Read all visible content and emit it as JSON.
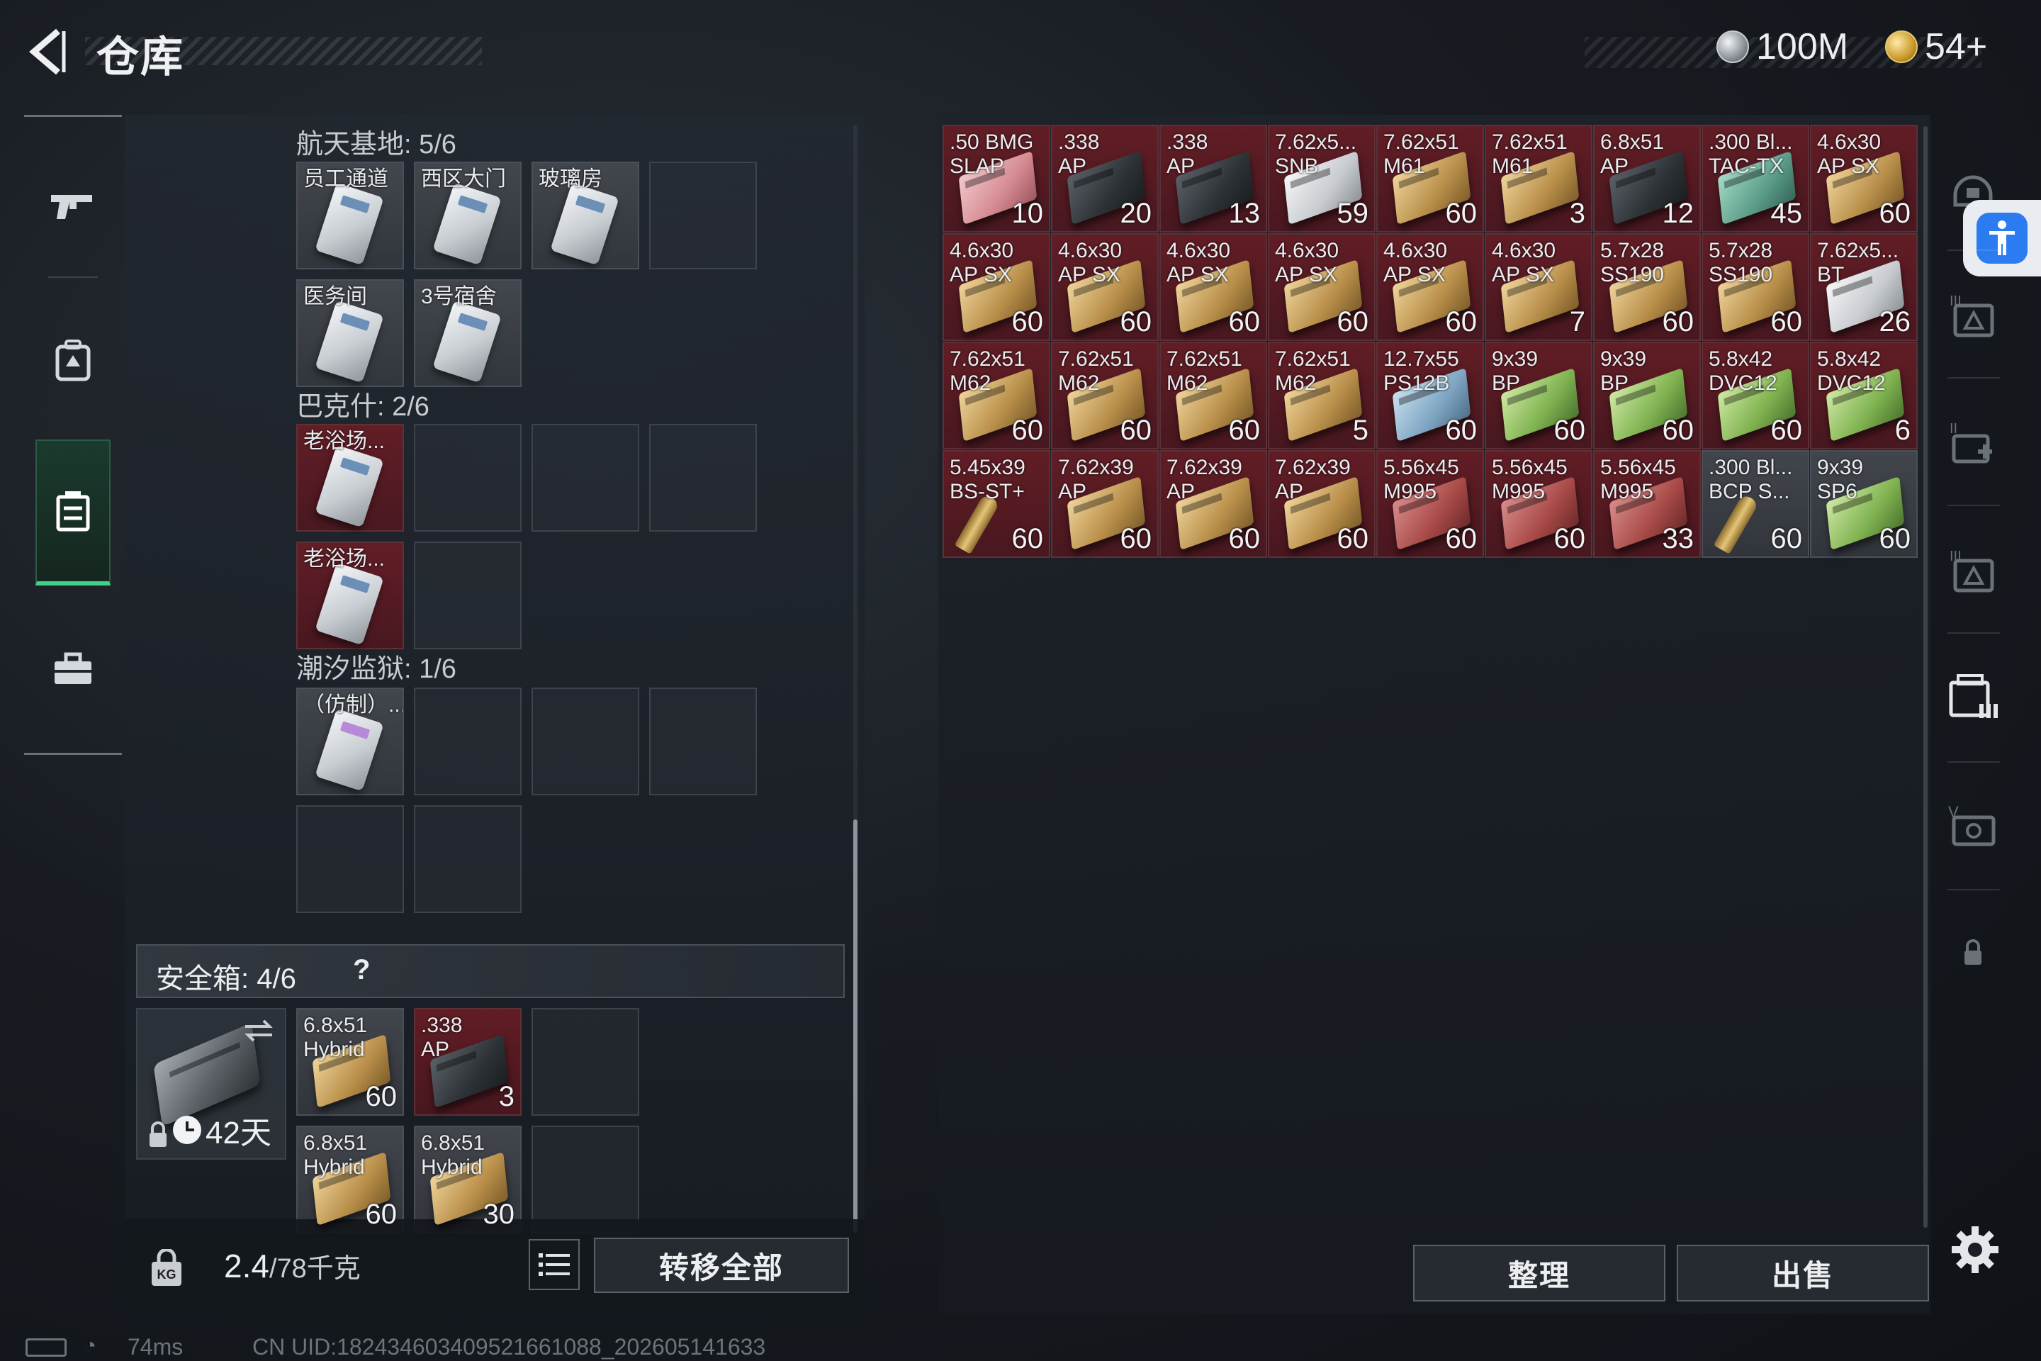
{
  "header": {
    "title": "仓库",
    "currencies": [
      {
        "icon": "silver-coin-icon",
        "value": "100M"
      },
      {
        "icon": "gold-coin-icon",
        "value": "54+"
      }
    ]
  },
  "left_nav": {
    "items": [
      {
        "name": "weapon",
        "icon": "gun-icon",
        "active": false
      },
      {
        "name": "equipment",
        "icon": "backpack-icon",
        "active": false
      },
      {
        "name": "storage",
        "icon": "container-icon",
        "active": true
      },
      {
        "name": "toolbox",
        "icon": "toolbox-icon",
        "active": false
      }
    ]
  },
  "keycard_sections": [
    {
      "title": "航天基地: 5/6",
      "cells": [
        {
          "label": "员工通道",
          "type": "keycard"
        },
        {
          "label": "西区大门",
          "type": "keycard"
        },
        {
          "label": "玻璃房",
          "type": "keycard"
        },
        {
          "label": "",
          "type": "empty"
        },
        {
          "label": "医务间",
          "type": "keycard"
        },
        {
          "label": "3号宿舍",
          "type": "keycard"
        }
      ]
    },
    {
      "title": "巴克什: 2/6",
      "cells": [
        {
          "label": "老浴场...",
          "type": "keycard-red"
        },
        {
          "label": "",
          "type": "empty"
        },
        {
          "label": "",
          "type": "empty"
        },
        {
          "label": "",
          "type": "empty"
        },
        {
          "label": "老浴场...",
          "type": "keycard-red"
        },
        {
          "label": "",
          "type": "empty"
        }
      ]
    },
    {
      "title": "潮汐监狱: 1/6",
      "cells": [
        {
          "label": "（仿制）...",
          "type": "keycard-fake"
        },
        {
          "label": "",
          "type": "empty"
        },
        {
          "label": "",
          "type": "empty"
        },
        {
          "label": "",
          "type": "empty"
        },
        {
          "label": "",
          "type": "empty"
        },
        {
          "label": "",
          "type": "empty"
        }
      ]
    }
  ],
  "safebox": {
    "label": "安全箱:  4/6",
    "help": "?",
    "case_days": "42天",
    "items": [
      {
        "line1": "6.8x51",
        "line2": "Hybrid",
        "qty": "60",
        "box": "tan"
      },
      {
        "line1": ".338",
        "line2": "AP",
        "qty": "3",
        "box": "dark",
        "red": true
      },
      {
        "line1": "",
        "line2": "",
        "qty": "",
        "box": ""
      },
      {
        "line1": "6.8x51",
        "line2": "Hybrid",
        "qty": "60",
        "box": "tan"
      },
      {
        "line1": "6.8x51",
        "line2": "Hybrid",
        "qty": "30",
        "box": "tan"
      },
      {
        "line1": "",
        "line2": "",
        "qty": "",
        "box": ""
      }
    ]
  },
  "footer_left": {
    "weight_current": "2.4",
    "weight_capacity": "/78千克",
    "transfer_all": "转移全部"
  },
  "stash_items": [
    {
      "line1": ".50 BMG",
      "line2": "SLAP",
      "qty": "10",
      "box": "pink",
      "red": true
    },
    {
      "line1": ".338",
      "line2": "AP",
      "qty": "20",
      "box": "dark",
      "red": true
    },
    {
      "line1": ".338",
      "line2": "AP",
      "qty": "13",
      "box": "dark",
      "red": true
    },
    {
      "line1": "7.62x5...",
      "line2": "SNB",
      "qty": "59",
      "box": "white",
      "red": true
    },
    {
      "line1": "7.62x51",
      "line2": "M61",
      "qty": "60",
      "box": "tan",
      "red": true
    },
    {
      "line1": "7.62x51",
      "line2": "M61",
      "qty": "3",
      "box": "tan",
      "red": true
    },
    {
      "line1": "6.8x51",
      "line2": "AP",
      "qty": "12",
      "box": "dark",
      "red": true
    },
    {
      "line1": ".300 Bl...",
      "line2": "TAC-TX",
      "qty": "45",
      "box": "teal",
      "red": true
    },
    {
      "line1": "4.6x30",
      "line2": "AP SX",
      "qty": "60",
      "box": "tan",
      "red": true
    },
    {
      "line1": "4.6x30",
      "line2": "AP SX",
      "qty": "60",
      "box": "tan",
      "red": true
    },
    {
      "line1": "4.6x30",
      "line2": "AP SX",
      "qty": "60",
      "box": "tan",
      "red": true
    },
    {
      "line1": "4.6x30",
      "line2": "AP SX",
      "qty": "60",
      "box": "tan",
      "red": true
    },
    {
      "line1": "4.6x30",
      "line2": "AP SX",
      "qty": "60",
      "box": "tan",
      "red": true
    },
    {
      "line1": "4.6x30",
      "line2": "AP SX",
      "qty": "60",
      "box": "tan",
      "red": true
    },
    {
      "line1": "4.6x30",
      "line2": "AP SX",
      "qty": "7",
      "box": "tan",
      "red": true
    },
    {
      "line1": "5.7x28",
      "line2": "SS190",
      "qty": "60",
      "box": "tan",
      "red": true
    },
    {
      "line1": "5.7x28",
      "line2": "SS190",
      "qty": "60",
      "box": "tan",
      "red": true
    },
    {
      "line1": "7.62x5...",
      "line2": "BT",
      "qty": "26",
      "box": "white",
      "red": true
    },
    {
      "line1": "7.62x51",
      "line2": "M62",
      "qty": "60",
      "box": "tan",
      "red": true
    },
    {
      "line1": "7.62x51",
      "line2": "M62",
      "qty": "60",
      "box": "tan",
      "red": true
    },
    {
      "line1": "7.62x51",
      "line2": "M62",
      "qty": "60",
      "box": "tan",
      "red": true
    },
    {
      "line1": "7.62x51",
      "line2": "M62",
      "qty": "5",
      "box": "tan",
      "red": true
    },
    {
      "line1": "12.7x55",
      "line2": "PS12B",
      "qty": "60",
      "box": "blue",
      "red": true
    },
    {
      "line1": "9x39",
      "line2": "BP",
      "qty": "60",
      "box": "green",
      "red": true
    },
    {
      "line1": "9x39",
      "line2": "BP",
      "qty": "60",
      "box": "green",
      "red": true
    },
    {
      "line1": "5.8x42",
      "line2": "DVC12",
      "qty": "60",
      "box": "green",
      "red": true
    },
    {
      "line1": "5.8x42",
      "line2": "DVC12",
      "qty": "6",
      "box": "green",
      "red": true
    },
    {
      "line1": "5.45x39",
      "line2": "BS-ST+",
      "qty": "60",
      "box": "round",
      "red": true
    },
    {
      "line1": "7.62x39",
      "line2": "AP",
      "qty": "60",
      "box": "tan",
      "red": true
    },
    {
      "line1": "7.62x39",
      "line2": "AP",
      "qty": "60",
      "box": "tan",
      "red": true
    },
    {
      "line1": "7.62x39",
      "line2": "AP",
      "qty": "60",
      "box": "tan",
      "red": true
    },
    {
      "line1": "5.56x45",
      "line2": "M995",
      "qty": "60",
      "box": "redbox",
      "red": true
    },
    {
      "line1": "5.56x45",
      "line2": "M995",
      "qty": "60",
      "box": "redbox",
      "red": true
    },
    {
      "line1": "5.56x45",
      "line2": "M995",
      "qty": "33",
      "box": "redbox",
      "red": true
    },
    {
      "line1": ".300 Bl...",
      "line2": "BCP S...",
      "qty": "60",
      "box": "round",
      "red": false
    },
    {
      "line1": "9x39",
      "line2": "SP6",
      "qty": "60",
      "box": "green",
      "red": false
    }
  ],
  "footer_right": {
    "sort": "整理",
    "sell": "出售"
  },
  "status": {
    "ping": "74ms",
    "uid": "CN UID:182434603409521661088_202605141633"
  },
  "colors": {
    "accent_green": "#3fd08a",
    "item_red": "#6e1c24",
    "a11y_blue": "#2b7cf0"
  }
}
